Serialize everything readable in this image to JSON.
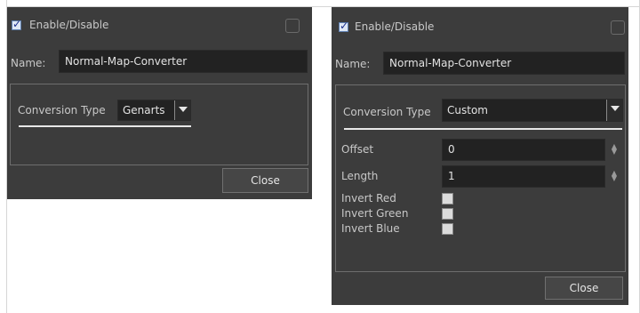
{
  "left_dialog": {
    "enable_label": "Enable/Disable",
    "name_label": "Name:",
    "name_value": "Normal-Map-Converter",
    "conversion_type_label": "Conversion Type",
    "conversion_type_value": "Genarts",
    "close_label": "Close"
  },
  "right_dialog": {
    "enable_label": "Enable/Disable",
    "name_label": "Name:",
    "name_value": "Normal-Map-Converter",
    "conversion_type_label": "Conversion Type",
    "conversion_type_value": "Custom",
    "offset_label": "Offset",
    "offset_value": "0",
    "length_label": "Length",
    "length_value": "1",
    "invert_red_label": "Invert Red",
    "invert_green_label": "Invert Green",
    "invert_blue_label": "Invert Blue",
    "close_label": "Close"
  }
}
